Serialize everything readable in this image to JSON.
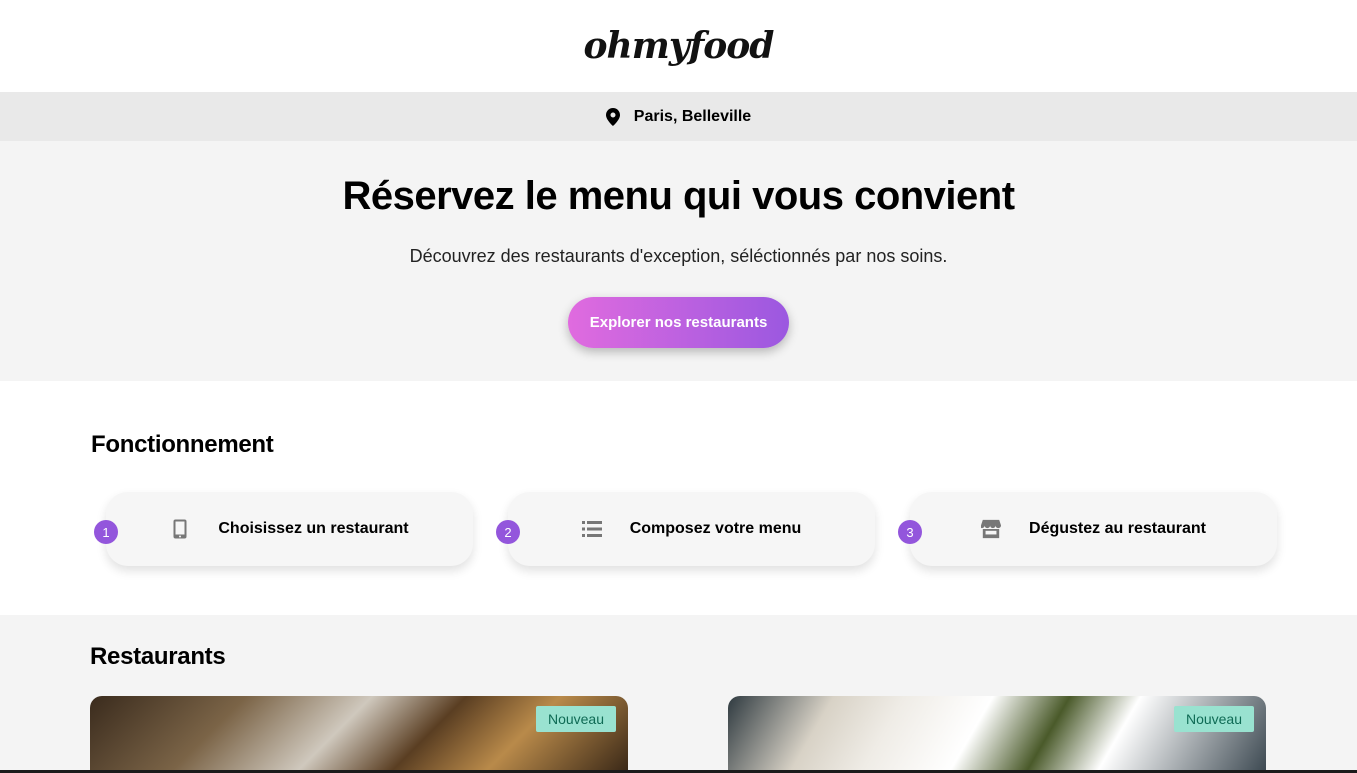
{
  "header": {
    "logo": "ohmyfood"
  },
  "location": {
    "text": "Paris, Belleville",
    "icon": "map-pin-icon"
  },
  "hero": {
    "title": "Réservez le menu qui vous convient",
    "subtitle": "Découvrez des restaurants d'exception, séléctionnés par nos soins.",
    "cta_label": "Explorer nos restaurants"
  },
  "how": {
    "title": "Fonctionnement",
    "steps": [
      {
        "number": "1",
        "label": "Choisissez un restaurant",
        "icon": "mobile-phone-icon"
      },
      {
        "number": "2",
        "label": "Composez votre menu",
        "icon": "list-icon"
      },
      {
        "number": "3",
        "label": "Dégustez au restaurant",
        "icon": "store-icon"
      }
    ]
  },
  "restaurants": {
    "title": "Restaurants",
    "items": [
      {
        "badge": "Nouveau"
      },
      {
        "badge": "Nouveau"
      }
    ]
  },
  "colors": {
    "accent": "#9356dc",
    "gradient_start": "#e06bdf",
    "gradient_end": "#9b58e0",
    "badge_bg": "#99e2d0",
    "badge_text": "#0f6b55"
  }
}
